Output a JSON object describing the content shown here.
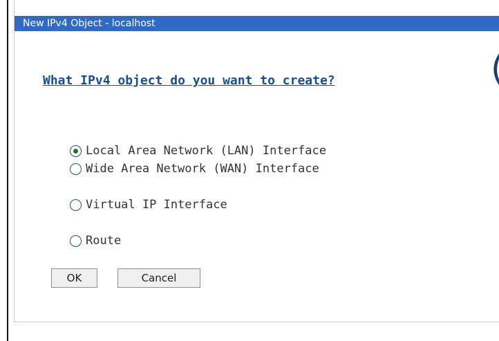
{
  "window": {
    "title": "New IPv4 Object - localhost"
  },
  "main": {
    "question": "What IPv4 object do you want to create?",
    "clipped_glyph": "("
  },
  "options": [
    {
      "label": "Local Area Network (LAN) Interface",
      "selected": true
    },
    {
      "label": "Wide Area Network (WAN) Interface",
      "selected": false
    },
    {
      "label": "Virtual IP Interface",
      "selected": false
    },
    {
      "label": "Route",
      "selected": false
    }
  ],
  "buttons": {
    "ok_label": "OK",
    "cancel_label": "Cancel"
  },
  "colors": {
    "titlebar": "#316ac5",
    "heading": "#1b4f8a",
    "selected_dot": "#2d6c3a"
  }
}
